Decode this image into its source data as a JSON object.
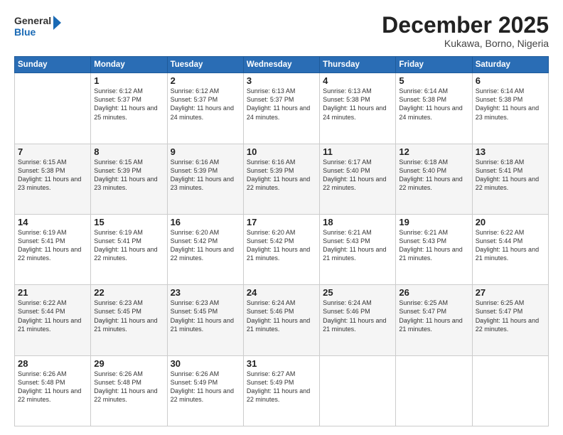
{
  "header": {
    "logo_line1": "General",
    "logo_line2": "Blue",
    "month": "December 2025",
    "location": "Kukawa, Borno, Nigeria"
  },
  "weekdays": [
    "Sunday",
    "Monday",
    "Tuesday",
    "Wednesday",
    "Thursday",
    "Friday",
    "Saturday"
  ],
  "weeks": [
    [
      {
        "day": "",
        "sunrise": "",
        "sunset": "",
        "daylight": ""
      },
      {
        "day": "1",
        "sunrise": "Sunrise: 6:12 AM",
        "sunset": "Sunset: 5:37 PM",
        "daylight": "Daylight: 11 hours and 25 minutes."
      },
      {
        "day": "2",
        "sunrise": "Sunrise: 6:12 AM",
        "sunset": "Sunset: 5:37 PM",
        "daylight": "Daylight: 11 hours and 24 minutes."
      },
      {
        "day": "3",
        "sunrise": "Sunrise: 6:13 AM",
        "sunset": "Sunset: 5:37 PM",
        "daylight": "Daylight: 11 hours and 24 minutes."
      },
      {
        "day": "4",
        "sunrise": "Sunrise: 6:13 AM",
        "sunset": "Sunset: 5:38 PM",
        "daylight": "Daylight: 11 hours and 24 minutes."
      },
      {
        "day": "5",
        "sunrise": "Sunrise: 6:14 AM",
        "sunset": "Sunset: 5:38 PM",
        "daylight": "Daylight: 11 hours and 24 minutes."
      },
      {
        "day": "6",
        "sunrise": "Sunrise: 6:14 AM",
        "sunset": "Sunset: 5:38 PM",
        "daylight": "Daylight: 11 hours and 23 minutes."
      }
    ],
    [
      {
        "day": "7",
        "sunrise": "Sunrise: 6:15 AM",
        "sunset": "Sunset: 5:38 PM",
        "daylight": "Daylight: 11 hours and 23 minutes."
      },
      {
        "day": "8",
        "sunrise": "Sunrise: 6:15 AM",
        "sunset": "Sunset: 5:39 PM",
        "daylight": "Daylight: 11 hours and 23 minutes."
      },
      {
        "day": "9",
        "sunrise": "Sunrise: 6:16 AM",
        "sunset": "Sunset: 5:39 PM",
        "daylight": "Daylight: 11 hours and 23 minutes."
      },
      {
        "day": "10",
        "sunrise": "Sunrise: 6:16 AM",
        "sunset": "Sunset: 5:39 PM",
        "daylight": "Daylight: 11 hours and 22 minutes."
      },
      {
        "day": "11",
        "sunrise": "Sunrise: 6:17 AM",
        "sunset": "Sunset: 5:40 PM",
        "daylight": "Daylight: 11 hours and 22 minutes."
      },
      {
        "day": "12",
        "sunrise": "Sunrise: 6:18 AM",
        "sunset": "Sunset: 5:40 PM",
        "daylight": "Daylight: 11 hours and 22 minutes."
      },
      {
        "day": "13",
        "sunrise": "Sunrise: 6:18 AM",
        "sunset": "Sunset: 5:41 PM",
        "daylight": "Daylight: 11 hours and 22 minutes."
      }
    ],
    [
      {
        "day": "14",
        "sunrise": "Sunrise: 6:19 AM",
        "sunset": "Sunset: 5:41 PM",
        "daylight": "Daylight: 11 hours and 22 minutes."
      },
      {
        "day": "15",
        "sunrise": "Sunrise: 6:19 AM",
        "sunset": "Sunset: 5:41 PM",
        "daylight": "Daylight: 11 hours and 22 minutes."
      },
      {
        "day": "16",
        "sunrise": "Sunrise: 6:20 AM",
        "sunset": "Sunset: 5:42 PM",
        "daylight": "Daylight: 11 hours and 22 minutes."
      },
      {
        "day": "17",
        "sunrise": "Sunrise: 6:20 AM",
        "sunset": "Sunset: 5:42 PM",
        "daylight": "Daylight: 11 hours and 21 minutes."
      },
      {
        "day": "18",
        "sunrise": "Sunrise: 6:21 AM",
        "sunset": "Sunset: 5:43 PM",
        "daylight": "Daylight: 11 hours and 21 minutes."
      },
      {
        "day": "19",
        "sunrise": "Sunrise: 6:21 AM",
        "sunset": "Sunset: 5:43 PM",
        "daylight": "Daylight: 11 hours and 21 minutes."
      },
      {
        "day": "20",
        "sunrise": "Sunrise: 6:22 AM",
        "sunset": "Sunset: 5:44 PM",
        "daylight": "Daylight: 11 hours and 21 minutes."
      }
    ],
    [
      {
        "day": "21",
        "sunrise": "Sunrise: 6:22 AM",
        "sunset": "Sunset: 5:44 PM",
        "daylight": "Daylight: 11 hours and 21 minutes."
      },
      {
        "day": "22",
        "sunrise": "Sunrise: 6:23 AM",
        "sunset": "Sunset: 5:45 PM",
        "daylight": "Daylight: 11 hours and 21 minutes."
      },
      {
        "day": "23",
        "sunrise": "Sunrise: 6:23 AM",
        "sunset": "Sunset: 5:45 PM",
        "daylight": "Daylight: 11 hours and 21 minutes."
      },
      {
        "day": "24",
        "sunrise": "Sunrise: 6:24 AM",
        "sunset": "Sunset: 5:46 PM",
        "daylight": "Daylight: 11 hours and 21 minutes."
      },
      {
        "day": "25",
        "sunrise": "Sunrise: 6:24 AM",
        "sunset": "Sunset: 5:46 PM",
        "daylight": "Daylight: 11 hours and 21 minutes."
      },
      {
        "day": "26",
        "sunrise": "Sunrise: 6:25 AM",
        "sunset": "Sunset: 5:47 PM",
        "daylight": "Daylight: 11 hours and 21 minutes."
      },
      {
        "day": "27",
        "sunrise": "Sunrise: 6:25 AM",
        "sunset": "Sunset: 5:47 PM",
        "daylight": "Daylight: 11 hours and 22 minutes."
      }
    ],
    [
      {
        "day": "28",
        "sunrise": "Sunrise: 6:26 AM",
        "sunset": "Sunset: 5:48 PM",
        "daylight": "Daylight: 11 hours and 22 minutes."
      },
      {
        "day": "29",
        "sunrise": "Sunrise: 6:26 AM",
        "sunset": "Sunset: 5:48 PM",
        "daylight": "Daylight: 11 hours and 22 minutes."
      },
      {
        "day": "30",
        "sunrise": "Sunrise: 6:26 AM",
        "sunset": "Sunset: 5:49 PM",
        "daylight": "Daylight: 11 hours and 22 minutes."
      },
      {
        "day": "31",
        "sunrise": "Sunrise: 6:27 AM",
        "sunset": "Sunset: 5:49 PM",
        "daylight": "Daylight: 11 hours and 22 minutes."
      },
      {
        "day": "",
        "sunrise": "",
        "sunset": "",
        "daylight": ""
      },
      {
        "day": "",
        "sunrise": "",
        "sunset": "",
        "daylight": ""
      },
      {
        "day": "",
        "sunrise": "",
        "sunset": "",
        "daylight": ""
      }
    ]
  ]
}
